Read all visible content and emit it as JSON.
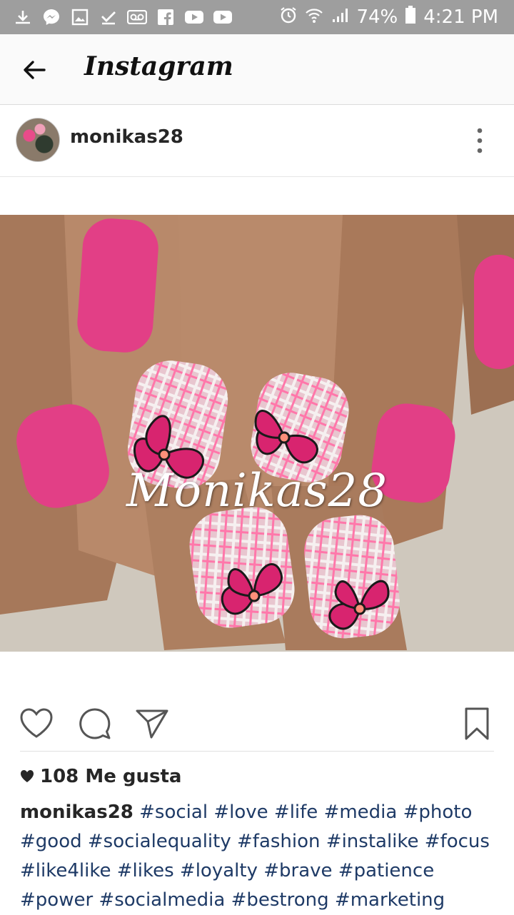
{
  "status_bar": {
    "battery": "74%",
    "time": "4:21 PM",
    "left_icons": [
      "download-icon",
      "messenger-icon",
      "gallery-icon",
      "check-icon",
      "voicemail-icon",
      "facebook-icon",
      "youtube-icon",
      "youtube-icon"
    ],
    "right_icons": [
      "alarm-icon",
      "wifi-icon",
      "signal-icon",
      "battery-icon"
    ]
  },
  "app_bar": {
    "title": "Instagram"
  },
  "post": {
    "username": "monikas28",
    "image_watermark": "Monikas28",
    "likes": "108 Me gusta",
    "caption_user": "monikas28",
    "hashtags": [
      "#social",
      "#love",
      "#life",
      "#media",
      "#photo",
      "#good",
      "#socialequality",
      "#fashion",
      "#instalike",
      "#focus",
      "#like4like",
      "#likes",
      "#loyalty",
      "#brave",
      "#patience",
      "#power",
      "#socialmedia",
      "#bestrong",
      "#marketing"
    ]
  },
  "colors": {
    "status_bar": "#9e9e9e",
    "hashtag": "#1e3a66",
    "nail_pink": "#e23f86"
  }
}
